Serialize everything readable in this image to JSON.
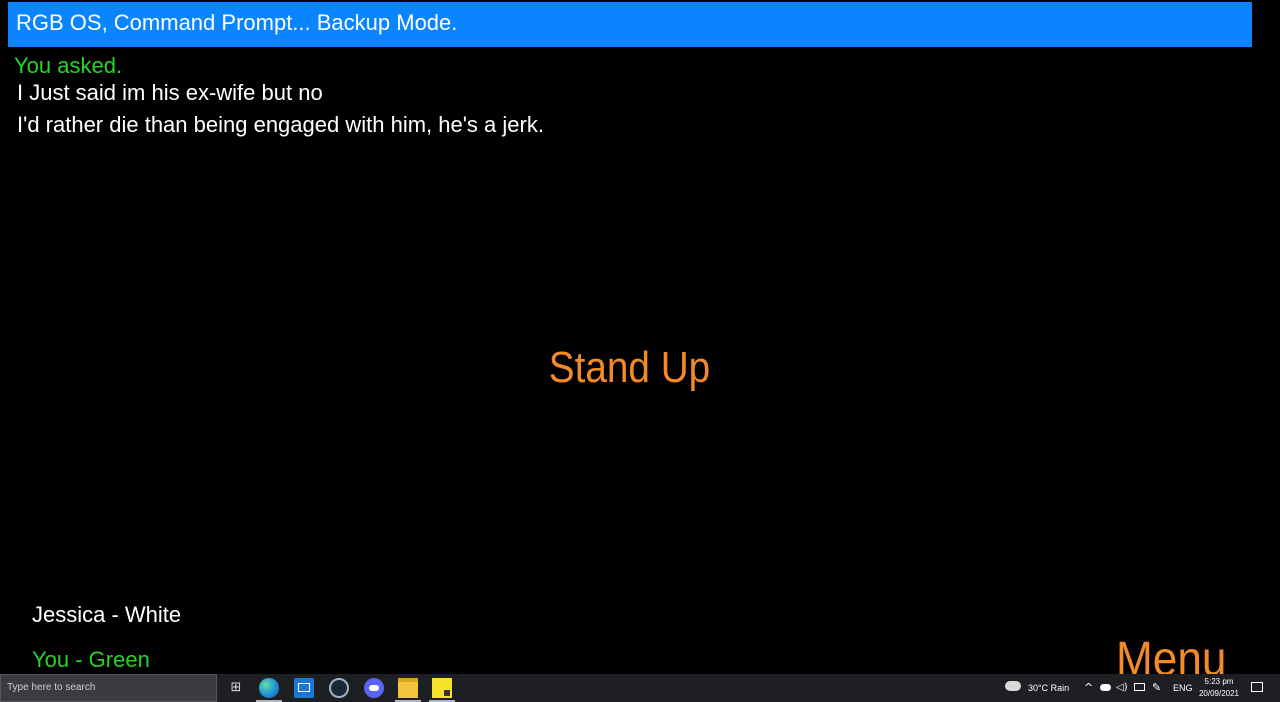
{
  "window": {
    "title": "RGB OS, Command Prompt... Backup Mode."
  },
  "conversation": {
    "prompt": "You asked.",
    "lines": [
      "I Just said im his ex-wife but no",
      "I'd rather die than being engaged with him, he's a jerk."
    ]
  },
  "center_action": {
    "label": "Stand Up"
  },
  "legend": {
    "white": "Jessica - White",
    "green": "You - Green"
  },
  "menu": {
    "label": "Menu"
  },
  "taskbar": {
    "search_placeholder": "Type here to search",
    "apps": [
      "task-view-icon",
      "edge-icon",
      "mail-icon",
      "steam-icon",
      "discord-icon",
      "file-explorer-icon",
      "sticky-notes-icon"
    ],
    "weather": "30°C  Rain",
    "language": "ENG",
    "time": "5:23 pm",
    "date": "20/09/2021"
  },
  "colors": {
    "title_bar": "#0a84ff",
    "user_text": "#28d428",
    "npc_text": "#ffffff",
    "accent_orange": "#f28a28",
    "background": "#000000"
  }
}
